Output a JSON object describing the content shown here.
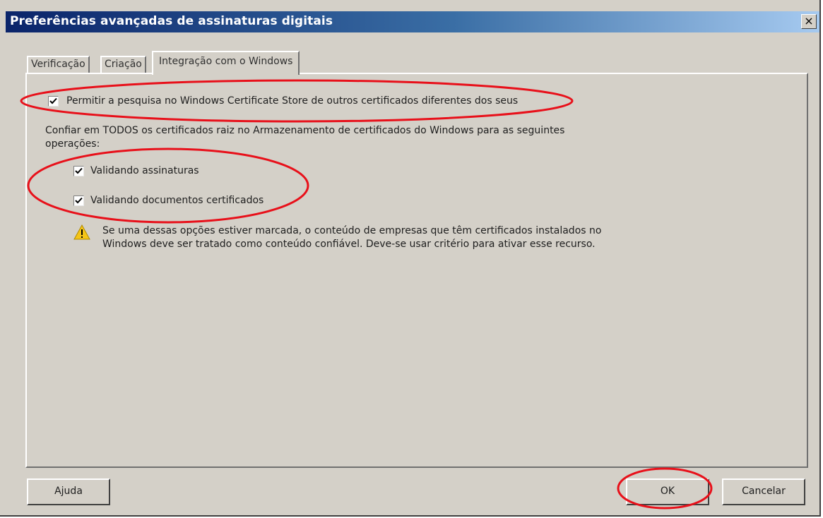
{
  "window": {
    "title": "Preferências avançadas de assinaturas digitais",
    "close_glyph": "×"
  },
  "tabs": [
    {
      "label": "Verificação",
      "active": false
    },
    {
      "label": "Criação",
      "active": false
    },
    {
      "label": "Integração com o Windows",
      "active": true
    }
  ],
  "panel": {
    "search_checkbox": {
      "label": "Permitir a pesquisa no Windows Certificate Store de outros certificados diferentes dos seus",
      "checked": true
    },
    "trust_paragraph": "Confiar em TODOS os certificados raiz no Armazenamento de certificados do Windows para as seguintes operações:",
    "validate_signatures": {
      "label": "Validando assinaturas",
      "checked": true
    },
    "validate_certified_docs": {
      "label": "Validando documentos certificados",
      "checked": true
    },
    "warning": {
      "icon": "warning-icon",
      "text": "Se uma dessas opções estiver marcada, o conteúdo de empresas que têm certificados instalados no Windows deve ser tratado como conteúdo confiável. Deve-se usar critério para ativar esse recurso."
    }
  },
  "buttons": {
    "help": "Ajuda",
    "ok": "OK",
    "cancel": "Cancelar"
  },
  "colors": {
    "dialog_face": "#d4d0c8",
    "titlebar_start": "#0a246a",
    "titlebar_end": "#a6caf0",
    "annotation": "#e8101a",
    "warning_yellow": "#f5c518"
  }
}
